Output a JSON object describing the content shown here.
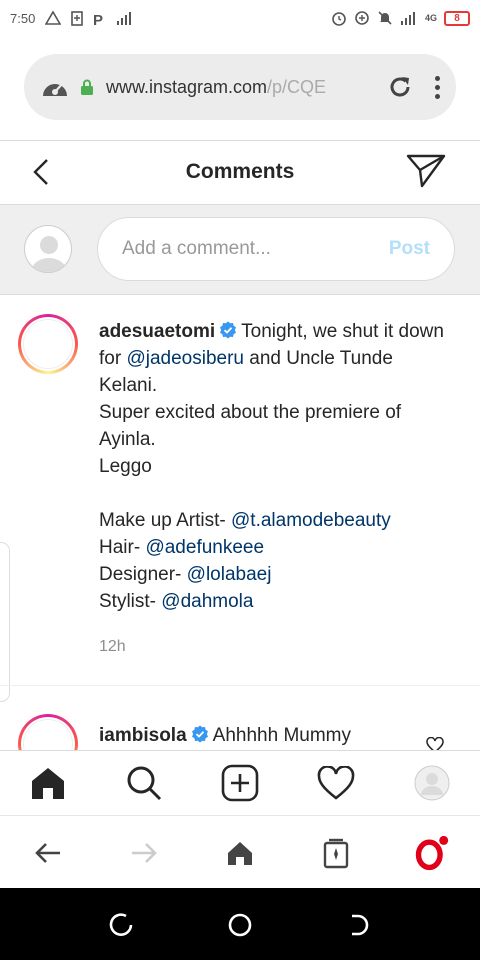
{
  "status_bar": {
    "time": "7:50",
    "network": "4G",
    "battery": "8"
  },
  "browser": {
    "url_main": "www.instagram.com",
    "url_rest": "/p/CQE",
    "secure": true
  },
  "header": {
    "title": "Comments"
  },
  "composer": {
    "placeholder": "Add a comment...",
    "post_label": "Post"
  },
  "caption": {
    "username": "adesuaetomi",
    "verified": true,
    "line1_text": "Tonight, we shut it down for ",
    "mention_1": "@jadeosiberu",
    "line1_end": " and Uncle Tunde Kelani.",
    "line2": "Super excited about the premiere of Ayinla.",
    "line3": "Leggo",
    "credits": [
      {
        "label": "Make up Artist- ",
        "mention": "@t.alamodebeauty"
      },
      {
        "label": "Hair- ",
        "mention": "@adefunkeee"
      },
      {
        "label": "Designer- ",
        "mention": "@lolabaej"
      },
      {
        "label": "Stylist- ",
        "mention": "@dahmola"
      }
    ],
    "timestamp": "12h"
  },
  "comment_2": {
    "username": "iambisola",
    "verified": true,
    "text": "Ahhhhh Mummy"
  },
  "colors": {
    "link": "#003569",
    "verified": "#3897f0",
    "post_disabled": "#b2dffc",
    "opera_red": "#e00019"
  }
}
